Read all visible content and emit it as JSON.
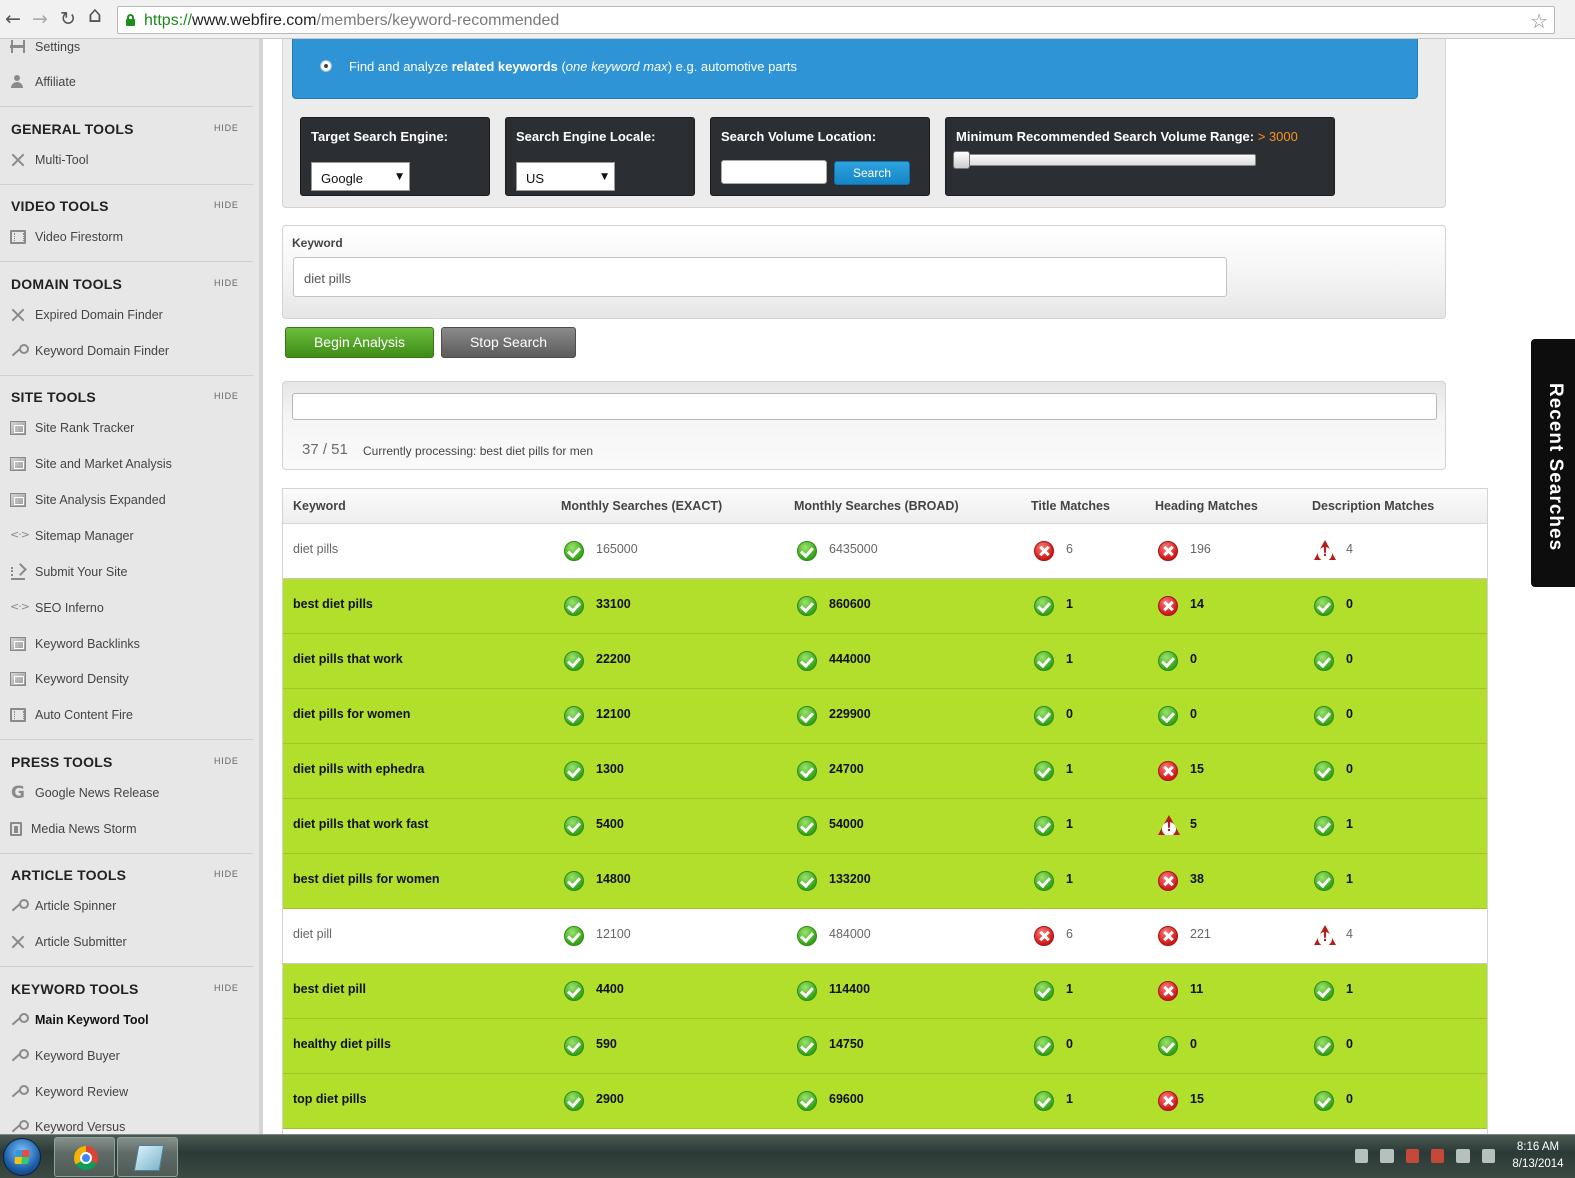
{
  "browser": {
    "url_scheme": "https://",
    "url_host": "www.webfire.com",
    "url_path": "/members/keyword-recommended",
    "back_icon": "←",
    "forward_icon": "→",
    "reload_icon": "↻",
    "home_icon": "⌂",
    "star_icon": "☆"
  },
  "sidebar": {
    "top_items": [
      {
        "label": "Settings",
        "icon": "sliders-icon"
      },
      {
        "label": "Affiliate",
        "icon": "user-icon"
      }
    ],
    "hide_label": "HIDE",
    "sections": [
      {
        "title": "GENERAL TOOLS",
        "items": [
          {
            "label": "Multi-Tool",
            "icon": "tools-icon"
          }
        ]
      },
      {
        "title": "VIDEO TOOLS",
        "items": [
          {
            "label": "Video Firestorm",
            "icon": "film-icon"
          }
        ]
      },
      {
        "title": "DOMAIN TOOLS",
        "items": [
          {
            "label": "Expired Domain Finder",
            "icon": "tools-icon"
          },
          {
            "label": "Keyword Domain Finder",
            "icon": "key-icon"
          }
        ]
      },
      {
        "title": "SITE TOOLS",
        "items": [
          {
            "label": "Site Rank Tracker",
            "icon": "image-icon"
          },
          {
            "label": "Site and Market Analysis",
            "icon": "image-icon"
          },
          {
            "label": "Site Analysis Expanded",
            "icon": "image-icon"
          },
          {
            "label": "Sitemap Manager",
            "icon": "code-icon"
          },
          {
            "label": "Submit Your Site",
            "icon": "upload-icon"
          },
          {
            "label": "SEO Inferno",
            "icon": "code-icon"
          },
          {
            "label": "Keyword Backlinks",
            "icon": "image-icon"
          },
          {
            "label": "Keyword Density",
            "icon": "image-icon"
          },
          {
            "label": "Auto Content Fire",
            "icon": "film-icon"
          }
        ]
      },
      {
        "title": "PRESS TOOLS",
        "items": [
          {
            "label": "Google News Release",
            "icon": "google-icon"
          },
          {
            "label": "Media News Storm",
            "icon": "bookmark-icon"
          }
        ]
      },
      {
        "title": "ARTICLE TOOLS",
        "items": [
          {
            "label": "Article Spinner",
            "icon": "key-icon"
          },
          {
            "label": "Article Submitter",
            "icon": "tools-icon"
          }
        ]
      },
      {
        "title": "KEYWORD TOOLS",
        "items": [
          {
            "label": "Main Keyword Tool",
            "icon": "key-icon",
            "active": true
          },
          {
            "label": "Keyword Buyer",
            "icon": "key-icon"
          },
          {
            "label": "Keyword Review",
            "icon": "key-icon"
          },
          {
            "label": "Keyword Versus",
            "icon": "key-icon"
          }
        ]
      }
    ]
  },
  "options": {
    "radio_prefix": "Find and analyze ",
    "radio_bold": "related keywords",
    "radio_paren_open": " (",
    "radio_italic": "one keyword max",
    "radio_suffix": ") e.g. automotive parts"
  },
  "settings": {
    "engine_label": "Target Search Engine:",
    "engine_value": "Google",
    "locale_label": "Search Engine Locale:",
    "locale_value": "US",
    "location_label": "Search Volume Location:",
    "location_value": "",
    "location_button": "Search",
    "volume_label": "Minimum Recommended Search Volume Range:",
    "volume_value": "> 3000",
    "volume_slider_fraction": 0
  },
  "keyword": {
    "label": "Keyword",
    "value": "diet pills"
  },
  "actions": {
    "begin": "Begin Analysis",
    "stop": "Stop Search"
  },
  "progress": {
    "count": "37 / 51",
    "status": "Currently processing: best diet pills for men",
    "fraction": 0
  },
  "results": {
    "columns": [
      "Keyword",
      "Monthly Searches (EXACT)",
      "Monthly Searches (BROAD)",
      "Title Matches",
      "Heading Matches",
      "Description Matches"
    ],
    "rows": [
      {
        "highlight": false,
        "keyword": "diet pills",
        "exact": "165000",
        "exact_s": "ok",
        "broad": "6435000",
        "broad_s": "ok",
        "title": "6",
        "title_s": "bad",
        "heading": "196",
        "heading_s": "bad",
        "desc": "4",
        "desc_s": "warn"
      },
      {
        "highlight": true,
        "keyword": "best diet pills",
        "exact": "33100",
        "exact_s": "ok",
        "broad": "860600",
        "broad_s": "ok",
        "title": "1",
        "title_s": "ok",
        "heading": "14",
        "heading_s": "bad",
        "desc": "0",
        "desc_s": "ok"
      },
      {
        "highlight": true,
        "keyword": "diet pills that work",
        "exact": "22200",
        "exact_s": "ok",
        "broad": "444000",
        "broad_s": "ok",
        "title": "1",
        "title_s": "ok",
        "heading": "0",
        "heading_s": "ok",
        "desc": "0",
        "desc_s": "ok"
      },
      {
        "highlight": true,
        "keyword": "diet pills for women",
        "exact": "12100",
        "exact_s": "ok",
        "broad": "229900",
        "broad_s": "ok",
        "title": "0",
        "title_s": "ok",
        "heading": "0",
        "heading_s": "ok",
        "desc": "0",
        "desc_s": "ok"
      },
      {
        "highlight": true,
        "keyword": "diet pills with ephedra",
        "exact": "1300",
        "exact_s": "ok",
        "broad": "24700",
        "broad_s": "ok",
        "title": "1",
        "title_s": "ok",
        "heading": "15",
        "heading_s": "bad",
        "desc": "0",
        "desc_s": "ok"
      },
      {
        "highlight": true,
        "keyword": "diet pills that work fast",
        "exact": "5400",
        "exact_s": "ok",
        "broad": "54000",
        "broad_s": "ok",
        "title": "1",
        "title_s": "ok",
        "heading": "5",
        "heading_s": "warn",
        "desc": "1",
        "desc_s": "ok"
      },
      {
        "highlight": true,
        "keyword": "best diet pills for women",
        "exact": "14800",
        "exact_s": "ok",
        "broad": "133200",
        "broad_s": "ok",
        "title": "1",
        "title_s": "ok",
        "heading": "38",
        "heading_s": "bad",
        "desc": "1",
        "desc_s": "ok"
      },
      {
        "highlight": false,
        "keyword": "diet pill",
        "exact": "12100",
        "exact_s": "ok",
        "broad": "484000",
        "broad_s": "ok",
        "title": "6",
        "title_s": "bad",
        "heading": "221",
        "heading_s": "bad",
        "desc": "4",
        "desc_s": "warn"
      },
      {
        "highlight": true,
        "keyword": "best diet pill",
        "exact": "4400",
        "exact_s": "ok",
        "broad": "114400",
        "broad_s": "ok",
        "title": "1",
        "title_s": "ok",
        "heading": "11",
        "heading_s": "bad",
        "desc": "1",
        "desc_s": "ok"
      },
      {
        "highlight": true,
        "keyword": "healthy diet pills",
        "exact": "590",
        "exact_s": "ok",
        "broad": "14750",
        "broad_s": "ok",
        "title": "0",
        "title_s": "ok",
        "heading": "0",
        "heading_s": "ok",
        "desc": "0",
        "desc_s": "ok"
      },
      {
        "highlight": true,
        "keyword": "top diet pills",
        "exact": "2900",
        "exact_s": "ok",
        "broad": "69600",
        "broad_s": "ok",
        "title": "1",
        "title_s": "ok",
        "heading": "15",
        "heading_s": "bad",
        "desc": "0",
        "desc_s": "ok"
      }
    ]
  },
  "recent_tab": "Recent Searches",
  "taskbar": {
    "time": "8:16 AM",
    "date": "8/13/2014"
  }
}
